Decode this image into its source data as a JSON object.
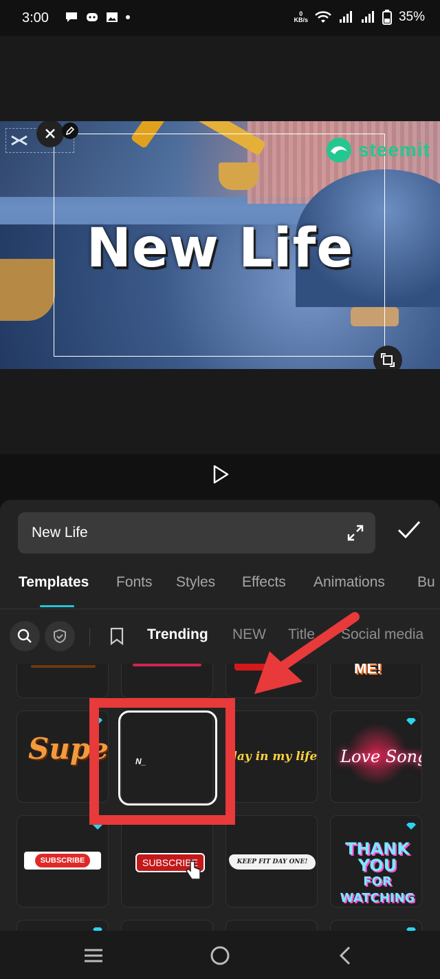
{
  "status_bar": {
    "time": "3:00",
    "net_speed_value": "0",
    "net_speed_unit": "KB/s",
    "battery_percent": "35%",
    "icons": [
      "chat-icon",
      "discord-icon",
      "gallery-icon",
      "dot-icon",
      "wifi-icon",
      "signal-icon",
      "signal-icon",
      "battery-icon"
    ]
  },
  "preview": {
    "title_text": "New Life",
    "watermark": "steemit"
  },
  "editor": {
    "text_value": "New Life",
    "tabs": [
      {
        "label": "Templates",
        "active": true
      },
      {
        "label": "Fonts",
        "active": false
      },
      {
        "label": "Styles",
        "active": false
      },
      {
        "label": "Effects",
        "active": false
      },
      {
        "label": "Animations",
        "active": false
      },
      {
        "label": "Bu",
        "active": false
      }
    ],
    "categories": [
      {
        "label": "Trending",
        "active": true
      },
      {
        "label": "NEW",
        "active": false
      },
      {
        "label": "Title",
        "active": false
      },
      {
        "label": "Social media",
        "active": false
      }
    ],
    "templates": {
      "super": "Super",
      "selected_preview": "N_",
      "day_in_life": "day in my life",
      "love_song": "Love Song",
      "subscribe1": "SUBSCRIBE",
      "subscribe2": "SUBSCRIBE",
      "keep_fit": "KEEP FIT DAY ONE!",
      "thank_you_l1": "THANK YOU",
      "thank_you_l2": "FOR WATCHING",
      "top_partial": "ME!"
    }
  },
  "colors": {
    "accent": "#28c3d8",
    "highlight_red": "#e8393b",
    "watermark_green": "#23c78f"
  }
}
